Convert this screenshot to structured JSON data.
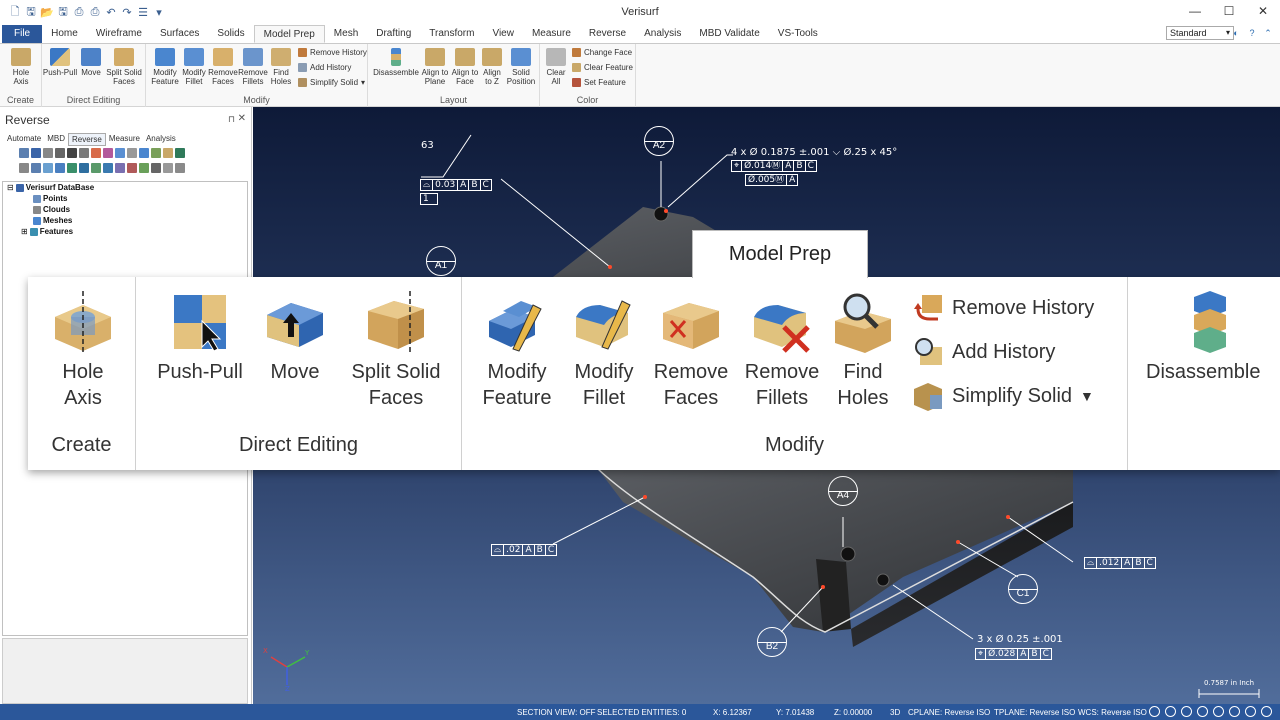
{
  "app": {
    "title": "Verisurf"
  },
  "window": {
    "minimize": "—",
    "maximize": "☐",
    "close": "✕"
  },
  "tabs": [
    "File",
    "Home",
    "Wireframe",
    "Surfaces",
    "Solids",
    "Model Prep",
    "Mesh",
    "Drafting",
    "Transform",
    "View",
    "Measure",
    "Reverse",
    "Analysis",
    "MBD Validate",
    "VS-Tools"
  ],
  "active_tab": "Model Prep",
  "style_select": {
    "value": "Standard"
  },
  "ribbon": {
    "create": {
      "title": "Create",
      "hole_axis": "Hole Axis"
    },
    "direct_editing": {
      "title": "Direct Editing",
      "push_pull": "Push-Pull",
      "move": "Move",
      "split_solid_faces": "Split Solid Faces"
    },
    "modify": {
      "title": "Modify",
      "modify_feature": "Modify Feature",
      "modify_fillet": "Modify Fillet",
      "remove_faces": "Remove Faces",
      "remove_fillets": "Remove Fillets",
      "find_holes": "Find Holes",
      "remove_history": "Remove History",
      "add_history": "Add History",
      "simplify_solid": "Simplify Solid"
    },
    "layout": {
      "title": "Layout",
      "disassemble": "Disassemble",
      "align_to_plane": "Align to Plane",
      "align_to_face": "Align to Face",
      "align_to_z": "Align to Z",
      "solid_position": "Solid Position"
    },
    "color": {
      "title": "Color",
      "clear_all": "Clear All",
      "change_face": "Change Face",
      "clear_feature": "Clear Feature",
      "set_feature": "Set Feature"
    }
  },
  "panel": {
    "title": "Reverse",
    "pin": "⊓",
    "close": "✕",
    "tabs": [
      "Automate",
      "MBD",
      "Reverse",
      "Measure",
      "Analysis"
    ],
    "active_tab": "Reverse",
    "tree": {
      "root": "Verisurf DataBase",
      "items": [
        "Points",
        "Clouds",
        "Meshes",
        "Features"
      ]
    }
  },
  "zoom": {
    "tab_label": "Model Prep",
    "create": {
      "title": "Create",
      "hole_axis": "Hole Axis"
    },
    "direct_editing": {
      "title": "Direct Editing",
      "push_pull": "Push-Pull",
      "move": "Move",
      "split_solid_faces": "Split Solid Faces"
    },
    "modify": {
      "title": "Modify",
      "modify_feature": "Modify Feature",
      "modify_fillet": "Modify Fillet",
      "remove_faces": "Remove Faces",
      "remove_fillets": "Remove Fillets",
      "find_holes": "Find Holes",
      "remove_history": "Remove History",
      "add_history": "Add History",
      "simplify_solid": "Simplify Solid"
    },
    "layout": {
      "disassemble": "Disassemble"
    }
  },
  "annotations": {
    "a63": "63",
    "fcf1": [
      "⌓",
      "0.03",
      "A",
      "B",
      "C"
    ],
    "datum1": "1",
    "a2_text": "4 x Ø 0.1875 ±.001  ⌵ Ø.25 x 45°",
    "fcf2": [
      "Ø.014Ⓜ",
      "A",
      "B",
      "C"
    ],
    "fcf3": [
      "Ø.005Ⓜ",
      "A"
    ],
    "fcf4": [
      "⌓",
      ".02",
      "A",
      "B",
      "C"
    ],
    "fcf5": [
      "⌓",
      ".012",
      "A",
      "B",
      "C"
    ],
    "c1_text": "3 x Ø 0.25 ±.001",
    "fcf6": [
      "⌖",
      "Ø.028",
      "A",
      "B",
      "C"
    ],
    "bubbles": {
      "a1": "A1",
      "a2": "A2",
      "a4": "A4",
      "b2": "B2",
      "c1": "C1"
    },
    "scale": "0.7587 in Inch",
    "axis_x": "X",
    "axis_y": "Y",
    "axis_z": "Z"
  },
  "status": {
    "section_view": "SECTION VIEW: OFF",
    "selected": "SELECTED ENTITIES: 0",
    "x": "X:   6.12367",
    "y": "Y:   7.01438",
    "z": "Z:   0.00000",
    "mode": "3D",
    "cplane": "CPLANE: Reverse ISO",
    "tplane": "TPLANE: Reverse ISO",
    "wcs": "WCS: Reverse ISO"
  }
}
